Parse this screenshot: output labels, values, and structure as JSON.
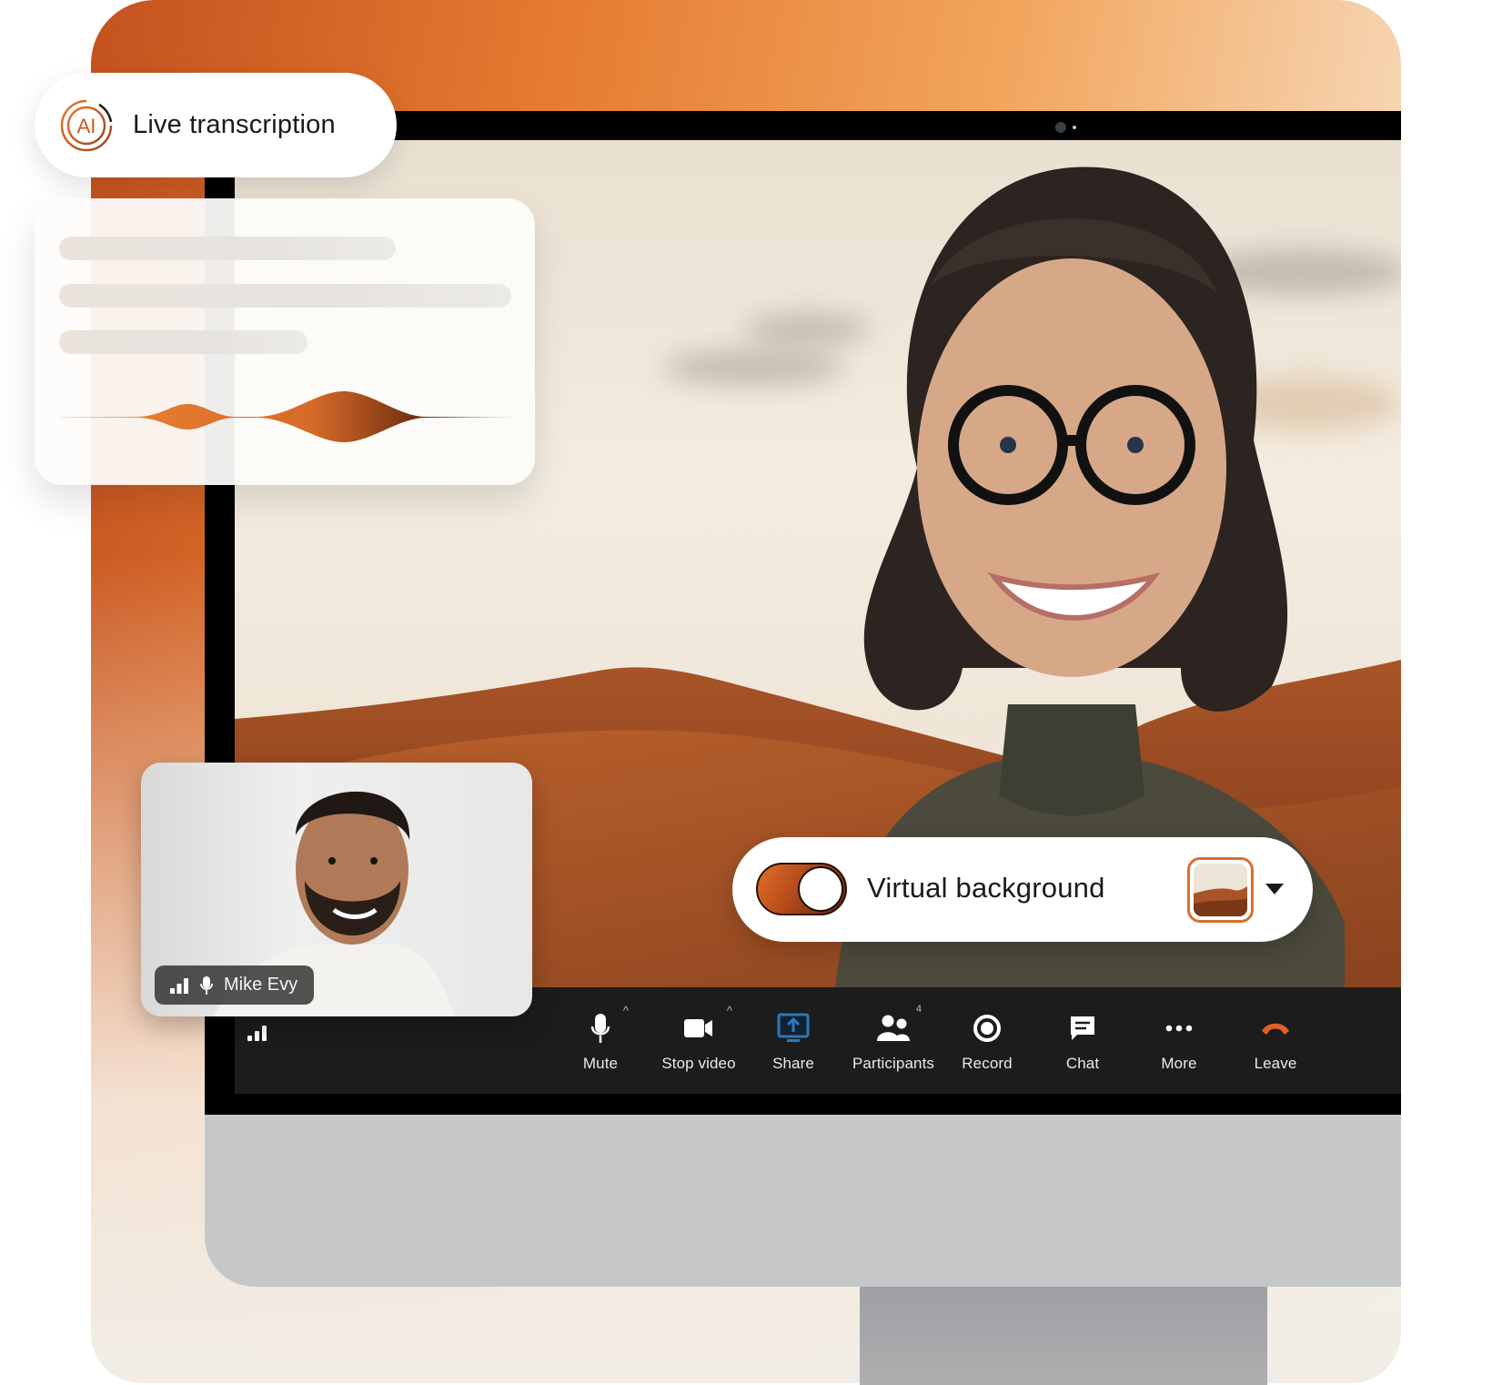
{
  "colors": {
    "accent_orange": "#e0702a",
    "toolbar_bg": "#1c1c1c",
    "share_blue": "#2f78b6",
    "leave_orange": "#e0602a",
    "monitor_chin": "#c6c7c9"
  },
  "live_transcription": {
    "icon": "ai-badge-icon",
    "icon_text": "AI",
    "label": "Live transcription"
  },
  "transcript_card": {
    "skeleton_lines": 3,
    "waveform": "audio-waveform"
  },
  "self_view": {
    "participant_name": "Mike Evy",
    "icons": [
      "signal-icon",
      "microphone-icon"
    ]
  },
  "virtual_background": {
    "label": "Virtual background",
    "toggle_on": true,
    "selected_thumbnail": "desert-dunes",
    "dropdown_icon": "caret-down-icon"
  },
  "toolbar": {
    "connection_icon": "signal-icon",
    "items": [
      {
        "label": "Mute",
        "icon": "microphone-icon",
        "has_caret": true
      },
      {
        "label": "Stop video",
        "icon": "video-camera-icon",
        "has_caret": true
      },
      {
        "label": "Share",
        "icon": "share-screen-icon",
        "active": true
      },
      {
        "label": "Participants",
        "icon": "participants-icon",
        "badge": "4"
      },
      {
        "label": "Record",
        "icon": "record-icon"
      },
      {
        "label": "Chat",
        "icon": "chat-icon"
      },
      {
        "label": "More",
        "icon": "more-icon"
      },
      {
        "label": "Leave",
        "icon": "leave-call-icon"
      }
    ]
  }
}
